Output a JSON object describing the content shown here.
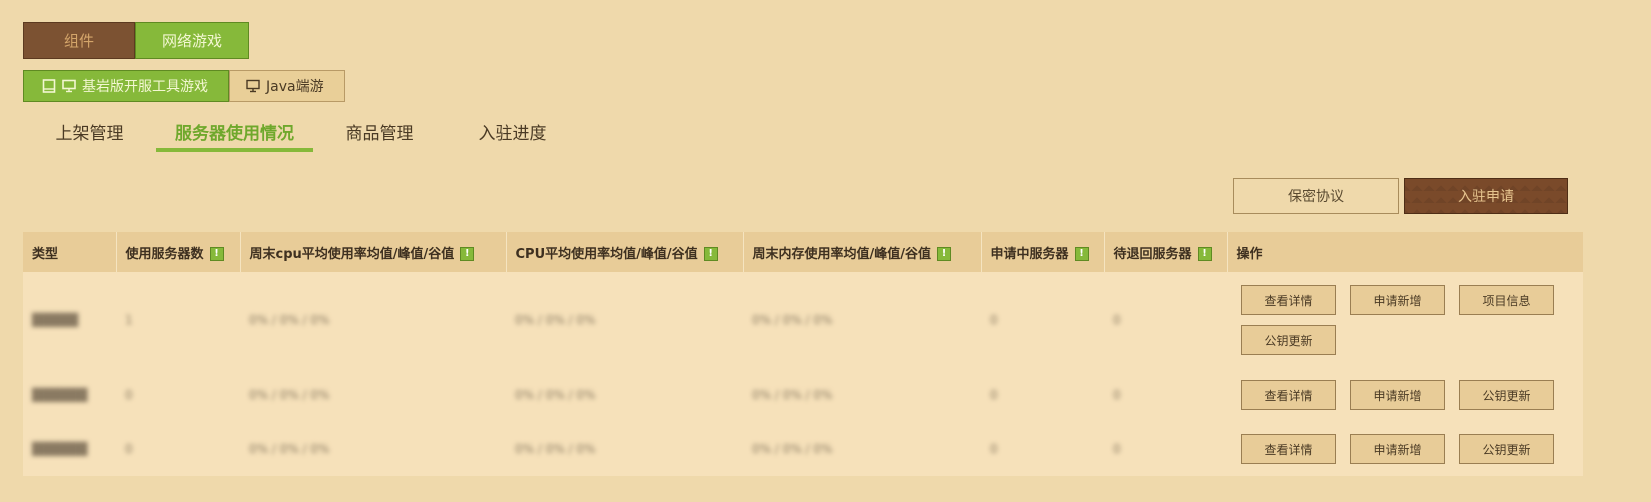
{
  "top_tabs": [
    {
      "label": "组件",
      "active": false
    },
    {
      "label": "网络游戏",
      "active": true
    }
  ],
  "sub_tabs": [
    {
      "label": "基岩版开服工具游戏",
      "active": true,
      "icons": [
        "tablet-icon",
        "monitor-icon"
      ]
    },
    {
      "label": "Java端游",
      "active": false,
      "icons": [
        "monitor-icon"
      ]
    }
  ],
  "nav": [
    {
      "label": "上架管理",
      "active": false
    },
    {
      "label": "服务器使用情况",
      "active": true
    },
    {
      "label": "商品管理",
      "active": false
    },
    {
      "label": "入驻进度",
      "active": false
    }
  ],
  "actions": {
    "secret_label": "保密协议",
    "apply_label": "入驻申请"
  },
  "table": {
    "headers": [
      "类型",
      "使用服务器数",
      "周末cpu平均使用率均值/峰值/谷值",
      "CPU平均使用率均值/峰值/谷值",
      "周末内存使用率均值/峰值/谷值",
      "申请中服务器",
      "待退回服务器",
      "操作"
    ],
    "info_badge": "!",
    "rows": [
      {
        "type": "█████",
        "count": "1",
        "weekend_cpu": "0% / 0% / 0%",
        "cpu": "0% / 0% / 0%",
        "weekend_mem": "0% / 0% / 0%",
        "applying": "0",
        "returning": "0",
        "ops": [
          "查看详情",
          "申请新增",
          "项目信息",
          "公钥更新"
        ]
      },
      {
        "type": "██████",
        "count": "0",
        "weekend_cpu": "0% / 0% / 0%",
        "cpu": "0% / 0% / 0%",
        "weekend_mem": "0% / 0% / 0%",
        "applying": "0",
        "returning": "0",
        "ops": [
          "查看详情",
          "申请新增",
          "公钥更新"
        ]
      },
      {
        "type": "██████",
        "count": "0",
        "weekend_cpu": "0% / 0% / 0%",
        "cpu": "0% / 0% / 0%",
        "weekend_mem": "0% / 0% / 0%",
        "applying": "0",
        "returning": "0",
        "ops": [
          "查看详情",
          "申请新增",
          "公钥更新"
        ]
      }
    ]
  },
  "colors": {
    "background": "#efd9ab",
    "accent_green": "#86b93a",
    "brown": "#7c5232",
    "header_bg": "#e8cc98",
    "row_bg": "#f6e1ba"
  }
}
